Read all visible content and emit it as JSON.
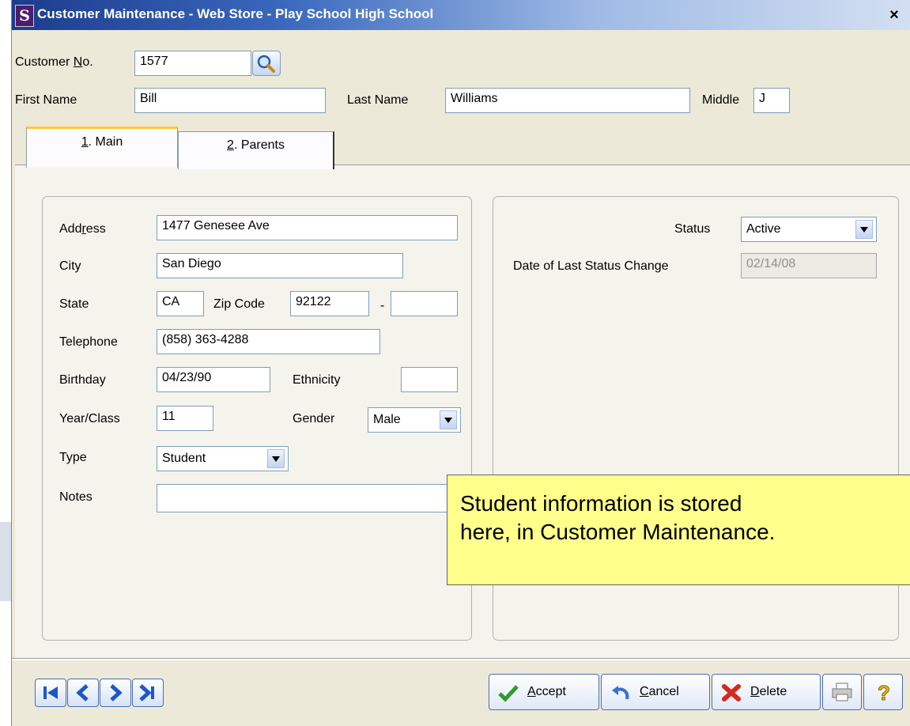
{
  "window": {
    "title": "Customer Maintenance - Web Store - Play School High School",
    "icon_letter": "S",
    "close_glyph": "×"
  },
  "header": {
    "customer_no_label_pre": "Customer ",
    "customer_no_label_ul": "N",
    "customer_no_label_post": "o.",
    "customer_no": "1577",
    "first_name_label": "First Name",
    "first_name": "Bill",
    "last_name_label": "Last Name",
    "last_name": "Williams",
    "middle_label": "Middle",
    "middle": "J"
  },
  "tabs": [
    {
      "num": "1",
      "rest": ". Main"
    },
    {
      "num": "2",
      "rest": ". Parents"
    }
  ],
  "main": {
    "address_label_pre": "Add",
    "address_label_ul": "r",
    "address_label_post": "ess",
    "address": "1477 Genesee Ave",
    "city_label": "City",
    "city": "San Diego",
    "state_label": "State",
    "state": "CA",
    "zip_label": "Zip Code",
    "zip": "92122",
    "zip_sep": "-",
    "zip_ext": "",
    "telephone_label": "Telephone",
    "telephone": "(858) 363-4288",
    "birthday_label": "Birthday",
    "birthday": "04/23/90",
    "ethnicity_label": "Ethnicity",
    "ethnicity": "",
    "year_class_label": "Year/Class",
    "year_class": "11",
    "gender_label": "Gender",
    "gender": "Male",
    "type_label": "Type",
    "type": "Student",
    "notes_label": "Notes",
    "notes": ""
  },
  "status": {
    "status_label": "Status",
    "status": "Active",
    "date_label": "Date of Last Status Change",
    "date": "02/14/08"
  },
  "buttons": {
    "accept_ul": "A",
    "accept_rest": "ccept",
    "cancel_ul": "C",
    "cancel_rest": "ancel",
    "delete_ul": "D",
    "delete_rest": "elete"
  },
  "callout": {
    "line1": "Student information is stored",
    "line2": "here, in Customer Maintenance."
  },
  "colors": {
    "title_bar": "#1c3c8c",
    "callout_bg": "#ffff8c",
    "nav_blue": "#1f57c6",
    "accept_green": "#2e9a2e",
    "delete_red": "#d42a1e"
  }
}
